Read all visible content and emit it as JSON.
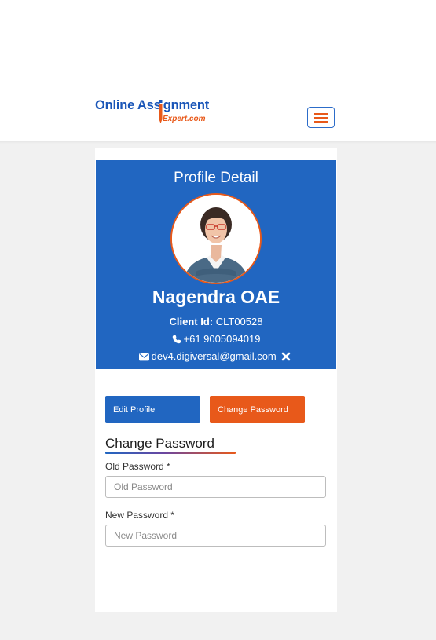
{
  "header": {
    "logo": {
      "text_part1": "Online Ass",
      "text_part2": "gnment",
      "subtext": "Expert.com"
    },
    "menu_button": "hamburger-menu"
  },
  "profile": {
    "panel_title": "Profile Detail",
    "name": "Nagendra OAE",
    "client_id_label": "Client Id:",
    "client_id": "CLT00528",
    "phone": "+61 9005094019",
    "email": "dev4.digiversal@gmail.com",
    "phone_icon": "phone-icon",
    "email_icon": "envelope-icon",
    "remove_icon": "close-icon"
  },
  "actions": {
    "edit_profile": "Edit Profile",
    "change_password": "Change Password"
  },
  "form": {
    "title": "Change Password",
    "old_password_label": "Old Password *",
    "old_password_placeholder": "Old Password",
    "new_password_label": "New Password *",
    "new_password_placeholder": "New Password"
  },
  "colors": {
    "brand_blue": "#2166c1",
    "brand_orange": "#e8591a"
  }
}
